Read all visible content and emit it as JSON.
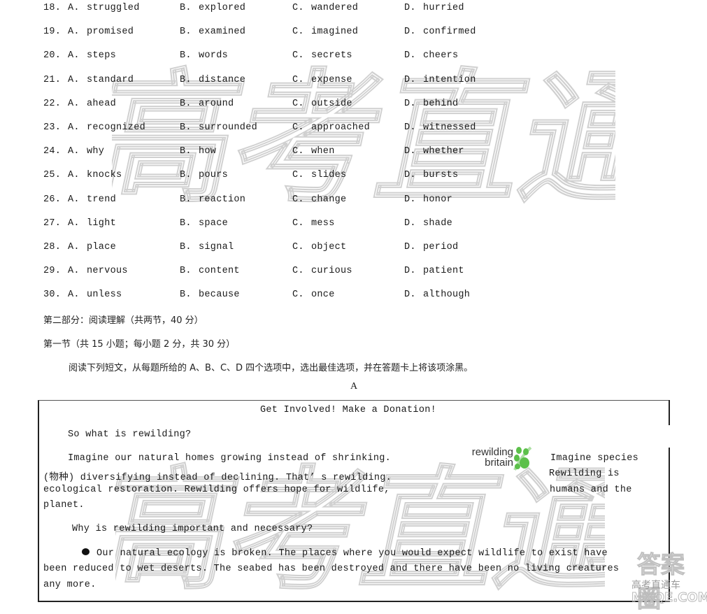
{
  "questions": [
    {
      "num": "18.",
      "a": "struggled",
      "b": "explored",
      "c": "wandered",
      "d": "hurried"
    },
    {
      "num": "19.",
      "a": "promised",
      "b": "examined",
      "c": "imagined",
      "d": "confirmed"
    },
    {
      "num": "20.",
      "a": "steps",
      "b": "words",
      "c": "secrets",
      "d": "cheers"
    },
    {
      "num": "21.",
      "a": "standard",
      "b": "distance",
      "c": "expense",
      "d": "intention"
    },
    {
      "num": "22.",
      "a": "ahead",
      "b": "around",
      "c": "outside",
      "d": "behind"
    },
    {
      "num": "23.",
      "a": "recognized",
      "b": "surrounded",
      "c": "approached",
      "d": "witnessed"
    },
    {
      "num": "24.",
      "a": "why",
      "b": "how",
      "c": "when",
      "d": "whether"
    },
    {
      "num": "25.",
      "a": "knocks",
      "b": "pours",
      "c": "slides",
      "d": "bursts"
    },
    {
      "num": "26.",
      "a": "trend",
      "b": "reaction",
      "c": "change",
      "d": "honor"
    },
    {
      "num": "27.",
      "a": "light",
      "b": "space",
      "c": "mess",
      "d": "shade"
    },
    {
      "num": "28.",
      "a": "place",
      "b": "signal",
      "c": "object",
      "d": "period"
    },
    {
      "num": "29.",
      "a": "nervous",
      "b": "content",
      "c": "curious",
      "d": "patient"
    },
    {
      "num": "30.",
      "a": "unless",
      "b": "because",
      "c": "once",
      "d": "although"
    }
  ],
  "option_letters": {
    "a": "A.",
    "b": "B.",
    "c": "C.",
    "d": "D."
  },
  "section": {
    "part_title": "第二部分：阅读理解（共两节，40 分）",
    "subsection_title": "第一节（共 15 小题；每小题 2 分，共 30 分）",
    "instruction": "阅读下列短文，从每题所给的 A、B、C、D 四个选项中，选出最佳选项，并在答题卡上将该项涂黑。",
    "passage_label": "A"
  },
  "passage": {
    "title": "Get Involved! Make a Donation!",
    "q1": "So what is rewilding?",
    "p1_line1_left": "Imagine our natural homes growing instead of shrinking.",
    "p1_line1_right": "Imagine species",
    "p1_line2_left": "(物种) diversifying instead of declining. That’ s rewilding.",
    "p1_line2_right": "Rewilding is",
    "p1_line3_left": "ecological restoration. Rewilding offers hope for wildlife,",
    "p1_line3_right": "humans and the",
    "p1_line4": "planet.",
    "q2": "Why is rewilding important and necessary?",
    "bullet_line1": "Our natural ecology is broken. The places where you would expect wildlife to exist have",
    "bullet_line2": "been reduced to wet deserts. The seabed has been destroyed and there have been no living creatures",
    "bullet_line3": "any more."
  },
  "logo": {
    "line1": "rewilding",
    "line2": "britain",
    "accent": "#5cc04a"
  },
  "watermarks": {
    "center": "高考直通车",
    "corner_top": "答案圈",
    "corner_mid": "高考直通车",
    "corner_bottom": "MXQE.COM"
  }
}
